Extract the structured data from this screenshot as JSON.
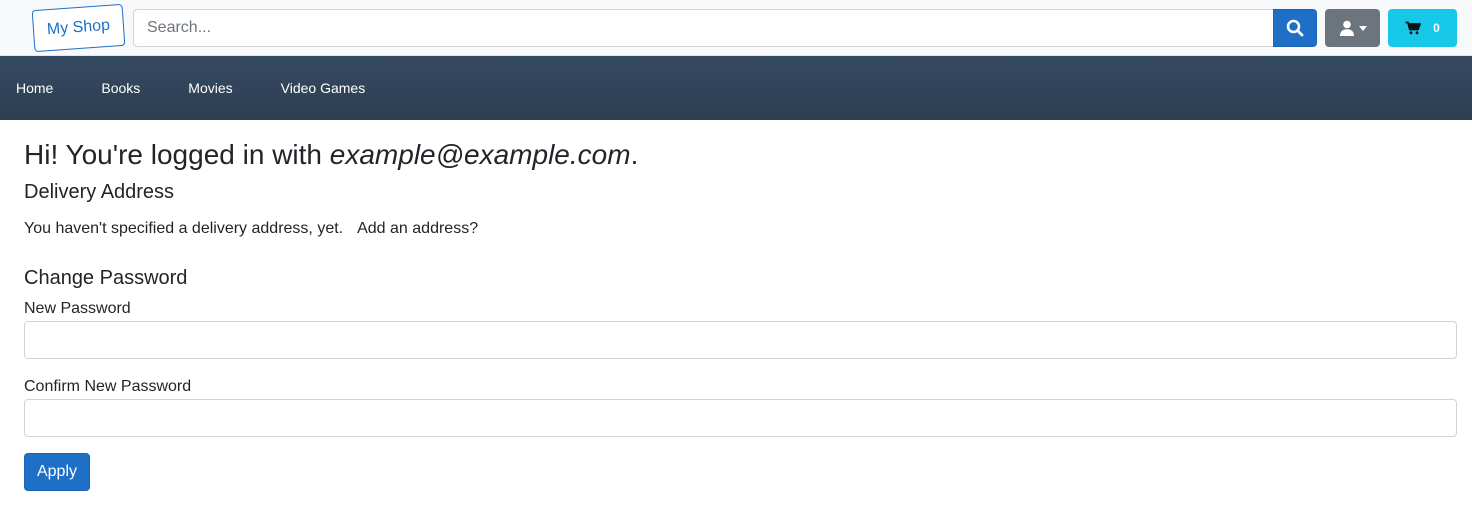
{
  "header": {
    "brand": "My Shop",
    "search_placeholder": "Search...",
    "search_icon": "search-icon",
    "user_icon": "user-icon",
    "cart_icon": "cart-icon",
    "cart_count": "0"
  },
  "nav": {
    "items": [
      {
        "label": "Home"
      },
      {
        "label": "Books"
      },
      {
        "label": "Movies"
      },
      {
        "label": "Video Games"
      }
    ]
  },
  "account": {
    "greeting_prefix": "Hi! You're logged in with ",
    "email": "example@example.com",
    "greeting_suffix": ".",
    "delivery_heading": "Delivery Address",
    "delivery_text": "You haven't specified a delivery address, yet.",
    "add_address_link": "Add an address?",
    "password_heading": "Change Password",
    "new_password_label": "New Password",
    "new_password_value": "",
    "confirm_password_label": "Confirm New Password",
    "confirm_password_value": "",
    "apply_label": "Apply"
  },
  "colors": {
    "primary": "#1f6fc6",
    "secondary": "#6c757d",
    "info": "#17c7e8",
    "nav_background": "#34495e"
  }
}
